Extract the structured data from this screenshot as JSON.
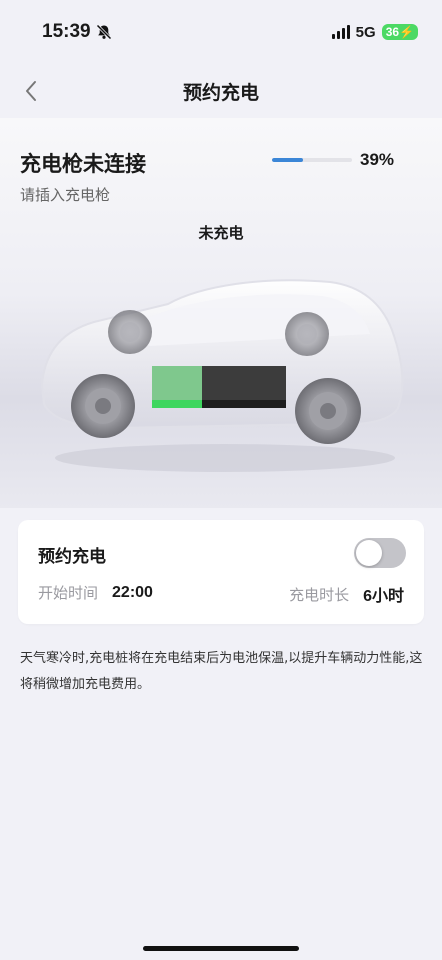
{
  "status_bar": {
    "time": "15:39",
    "network": "5G",
    "battery": "36",
    "silent_icon": "bell-slash-icon",
    "signal_icon": "cellular-signal-icon",
    "battery_icon": "battery-charging-icon"
  },
  "nav": {
    "title": "预约充电",
    "back_icon": "chevron-left-icon"
  },
  "charge_status": {
    "connection_title": "充电枪未连接",
    "connection_hint": "请插入充电枪",
    "battery_percent": "39%",
    "battery_level": 0.39,
    "charging_state": "未充电",
    "progress_color": "#3b86d7"
  },
  "schedule": {
    "title": "预约充电",
    "enabled": false,
    "start_label": "开始时间",
    "start_value": "22:00",
    "duration_label": "充电时长",
    "duration_value": "6小时"
  },
  "note": "天气寒冷时,充电桩将在充电结束后为电池保温,以提升车辆动力性能,这将稍微增加充电费用。"
}
